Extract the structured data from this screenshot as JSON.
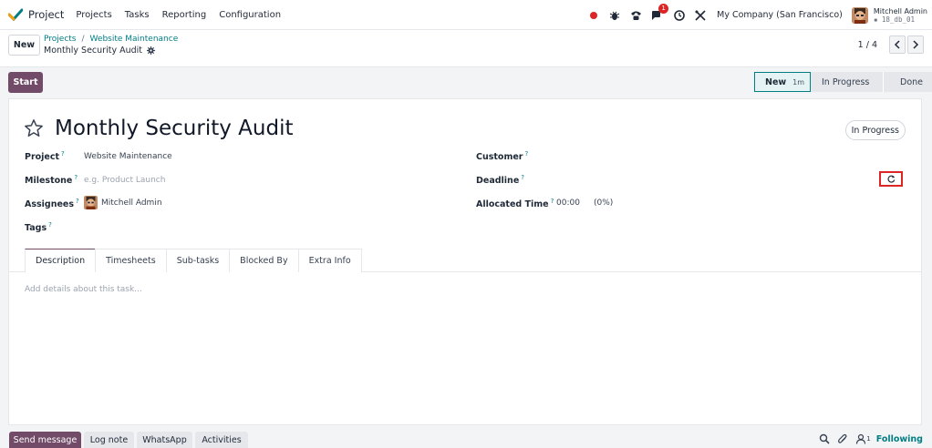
{
  "navbar": {
    "app_name": "Project",
    "menu": [
      "Projects",
      "Tasks",
      "Reporting",
      "Configuration"
    ],
    "messages_badge": "1",
    "company": "My Company (San Francisco)",
    "user_name": "Mitchell Admin",
    "user_db": "18_db_01",
    "icons": [
      "record-dot-icon",
      "bug-icon",
      "phone-icon",
      "chat-icon",
      "clock-icon",
      "tools-icon"
    ]
  },
  "control": {
    "new_label": "New",
    "breadcrumb": [
      "Projects",
      "Website Maintenance"
    ],
    "record_name": "Monthly Security Audit",
    "pager": "1 / 4"
  },
  "statusbar": {
    "start_label": "Start",
    "stages": [
      {
        "label": "New",
        "duration": "1m",
        "active": true
      },
      {
        "label": "In Progress",
        "active": false
      },
      {
        "label": "Done",
        "active": false
      }
    ]
  },
  "form": {
    "title": "Monthly Security Audit",
    "state": "In Progress",
    "fields": {
      "project_label": "Project",
      "project_value": "Website Maintenance",
      "milestone_label": "Milestone",
      "milestone_placeholder": "e.g. Product Launch",
      "assignees_label": "Assignees",
      "assignee_value": "Mitchell Admin",
      "tags_label": "Tags",
      "customer_label": "Customer",
      "deadline_label": "Deadline",
      "allocated_label": "Allocated Time",
      "allocated_value": "00:00",
      "allocated_pct": "(0%)",
      "help_mark": "?"
    },
    "tabs": [
      "Description",
      "Timesheets",
      "Sub-tasks",
      "Blocked By",
      "Extra Info"
    ],
    "active_tab": "Description",
    "description_placeholder": "Add details about this task..."
  },
  "chatter": {
    "send_message": "Send message",
    "log_note": "Log note",
    "whatsapp": "WhatsApp",
    "activities": "Activities",
    "followers_count": "1",
    "following": "Following"
  },
  "colors": {
    "brand": "#714b67",
    "link": "#017e84",
    "highlight": "#dc2626"
  }
}
